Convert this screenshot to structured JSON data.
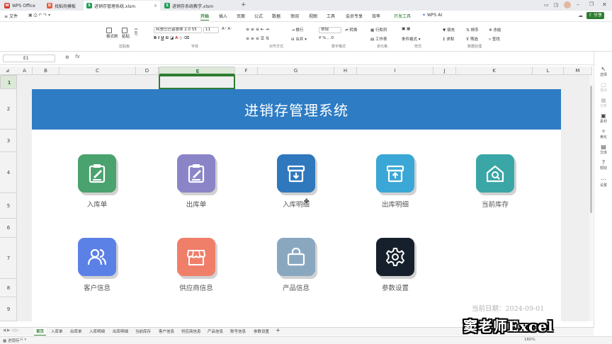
{
  "titlebar": {
    "tabs": [
      {
        "label": "WPS Office",
        "badge": "W",
        "color": "#d63c2f"
      },
      {
        "label": "找稻壳模板",
        "badge": "D",
        "color": "#e45b3c"
      },
      {
        "label": "进销存管理系统.xlsm",
        "badge": "S",
        "color": "#1f9d55"
      },
      {
        "label": "进销存系统教学.xlsm",
        "badge": "S",
        "color": "#1f9d55"
      }
    ],
    "add_tab": "+"
  },
  "menubar": {
    "file": "文件",
    "items": [
      "开始",
      "插入",
      "页面",
      "公式",
      "数据",
      "审阅",
      "视图",
      "工具",
      "会员专享",
      "效率",
      "开发工具",
      "WPS AI"
    ],
    "share": "分享"
  },
  "ribbon": {
    "groups": [
      "剪贴板",
      "字体",
      "对齐方式",
      "数字格式",
      "单元格",
      "样式",
      "数据处理"
    ],
    "buttons": {
      "format_painter": "格式刷",
      "paste": "粘贴",
      "wrap": "换行",
      "merge": "合并",
      "convert": "转换",
      "row_col": "行和列",
      "worksheet": "工作表",
      "cond_format": "条件格式",
      "fill": "填充",
      "sort": "排序",
      "freeze": "冻结",
      "sum": "求和",
      "filter": "筛选",
      "find": "查找"
    },
    "font_name": "阿里巴巴普惠体 2.0 55",
    "font_size": "11",
    "number_format": "常规"
  },
  "formulabar": {
    "cell_ref": "E1",
    "fx": "fx",
    "formula": ""
  },
  "columns": [
    "A",
    "B",
    "C",
    "D",
    "E",
    "F",
    "G",
    "H",
    "I",
    "J",
    "K",
    "L",
    "M"
  ],
  "selected_column": "E",
  "rows": [
    "1",
    "2",
    "3",
    "4",
    "5",
    "6",
    "7",
    "8",
    "9"
  ],
  "selected_row": "1",
  "dashboard": {
    "title": "进销存管理系统",
    "tiles": [
      {
        "label": "入库单",
        "color": "#4aa26e",
        "icon": "clipboard-edit-icon"
      },
      {
        "label": "出库单",
        "color": "#8b85c8",
        "icon": "clipboard-edit-icon"
      },
      {
        "label": "入库明细",
        "color": "#2f78bd",
        "icon": "inbox-download-icon"
      },
      {
        "label": "出库明细",
        "color": "#3aa7d6",
        "icon": "inbox-upload-icon"
      },
      {
        "label": "当前库存",
        "color": "#3aa6a6",
        "icon": "home-search-icon"
      },
      {
        "label": "客户信息",
        "color": "#5b80e6",
        "icon": "users-icon"
      },
      {
        "label": "供应商信息",
        "color": "#f07f6a",
        "icon": "storefront-icon"
      },
      {
        "label": "产品信息",
        "color": "#8aa7c0",
        "icon": "shopping-bag-icon"
      },
      {
        "label": "参数设置",
        "color": "#16202c",
        "icon": "gear-icon"
      }
    ],
    "date_label": "当前日期：2024-09-01"
  },
  "sheets": [
    "首页",
    "入库单",
    "出库单",
    "入库明细",
    "出库明细",
    "当前库存",
    "客户信息",
    "供应商信息",
    "产品信息",
    "账号信息",
    "参数设置"
  ],
  "active_sheet": "首页",
  "rightpanel": [
    "选择",
    "溜冰",
    "分析",
    "素材",
    "美化",
    "文库",
    "帮助",
    "设置"
  ],
  "status": {
    "sheet_name": "进销存",
    "zoom": "160%"
  },
  "watermark": "窦老师Excel"
}
